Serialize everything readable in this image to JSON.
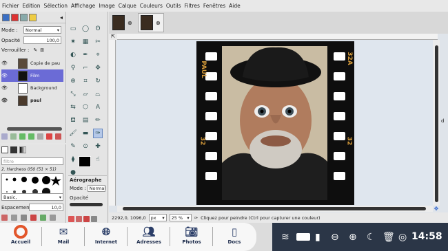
{
  "menubar": {
    "items": [
      "Fichier",
      "Edition",
      "Sélection",
      "Affichage",
      "Image",
      "Calque",
      "Couleurs",
      "Outils",
      "Filtres",
      "Fenêtres",
      "Aide"
    ]
  },
  "layers_dock": {
    "mode_label": "Mode :",
    "mode_value": "Normal",
    "opacity_label": "Opacité",
    "opacity_value": "100,0",
    "lock_label": "Verrouiller :",
    "layers": [
      {
        "name": "Copie de pau",
        "selected": false,
        "visible": true
      },
      {
        "name": "Film",
        "selected": true,
        "visible": true
      },
      {
        "name": "Background",
        "selected": false,
        "visible": true
      },
      {
        "name": "paul",
        "selected": false,
        "visible": true
      }
    ]
  },
  "brushes_dock": {
    "filter_placeholder": "filtre",
    "brush_name": "2. Hardness 050 (51 × 51)",
    "preset_value": "Basic,",
    "spacing_label": "Espacement",
    "spacing_value": "10,0"
  },
  "tool_options": {
    "title": "Aérographe",
    "mode_label": "Mode :",
    "mode_value": "Normal",
    "opacity_label": "Opacité"
  },
  "image_window": {
    "film_text_left": "PAUL",
    "film_text_right": "32A",
    "film_num_left": "32",
    "film_num_right": "32"
  },
  "statusbar": {
    "coords": "2292,0, 1096,0",
    "unit": "px",
    "zoom": "25 %",
    "message": "Cliquez pour peindre (Ctrl pour capturer une couleur)"
  },
  "taskbar": {
    "items": [
      {
        "label": "Accueil",
        "icon": "home-icon"
      },
      {
        "label": "Mail",
        "icon": "mail-icon"
      },
      {
        "label": "Internet",
        "icon": "globe-icon"
      },
      {
        "label": "Adresses",
        "icon": "contacts-icon"
      },
      {
        "label": "Photos",
        "icon": "camera-icon"
      },
      {
        "label": "Docs",
        "icon": "docs-icon"
      }
    ],
    "clock": "14:58"
  },
  "colors": {
    "selection": "#6b6bd6",
    "taskbar_dark": "#2b3647",
    "film_orange": "#d49a3a"
  }
}
